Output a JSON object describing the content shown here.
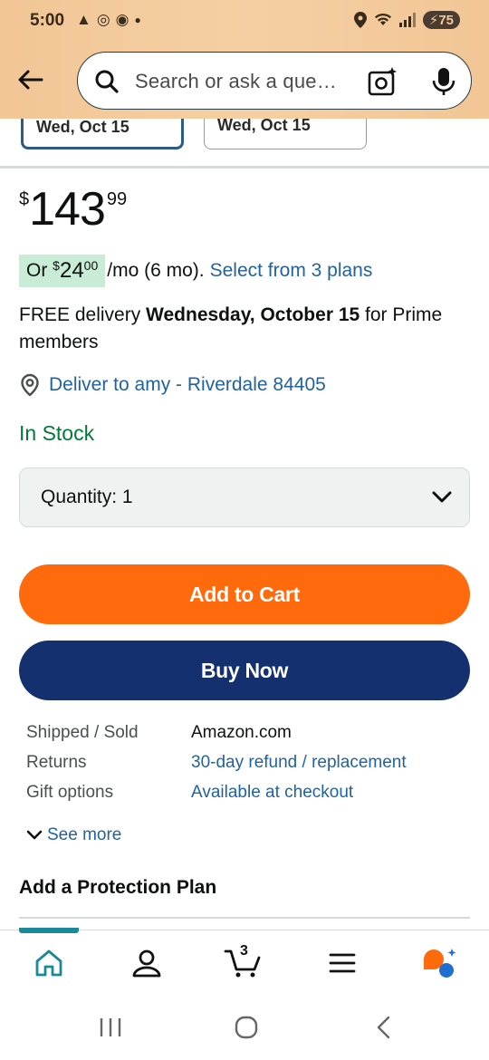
{
  "status_bar": {
    "time": "5:00",
    "battery": "75"
  },
  "search": {
    "placeholder": "Search or ask a que…"
  },
  "dates": {
    "selected": "Wed, Oct 15",
    "other": "Wed, Oct 15"
  },
  "price": {
    "currency": "$",
    "whole": "143",
    "fraction": "99"
  },
  "monthly": {
    "prefix": "Or ",
    "currency": "$",
    "amount_whole": "24",
    "amount_fraction": "00",
    "term": "/mo (6 mo).",
    "plans_link": "Select from 3 plans"
  },
  "delivery": {
    "prefix": "FREE delivery ",
    "date": "Wednesday, October 15",
    "suffix": " for Prime members"
  },
  "deliver_to": "Deliver to amy - Riverdale 84405",
  "stock": "In Stock",
  "quantity": {
    "label": "Quantity:",
    "value": "1"
  },
  "buttons": {
    "add_to_cart": "Add to Cart",
    "buy_now": "Buy Now"
  },
  "info_rows": [
    {
      "key": "Shipped / Sold",
      "value": "Amazon.com"
    },
    {
      "key": "Returns",
      "value": "30-day refund / replacement"
    },
    {
      "key": "Gift options",
      "value": "Available at checkout"
    }
  ],
  "see_more": "See more",
  "protection_heading": "Add a Protection Plan",
  "bottom_nav": {
    "cart_count": "3"
  },
  "colors": {
    "header_bg": "#f3c99a",
    "link": "#2162a1",
    "in_stock": "#007a37",
    "add_to_cart": "#ff6a0d",
    "buy_now": "#14306f",
    "monthly_badge": "#c9ecd6",
    "nav_accent": "#1a8a9a"
  },
  "icons": [
    "back-arrow-icon",
    "search-icon",
    "camera-icon",
    "mic-icon",
    "location-pin-icon",
    "chevron-down-icon",
    "home-icon",
    "account-icon",
    "cart-icon",
    "menu-icon",
    "rufus-ai-icon",
    "recents-icon",
    "home-circle-icon",
    "back-chevron-icon"
  ]
}
